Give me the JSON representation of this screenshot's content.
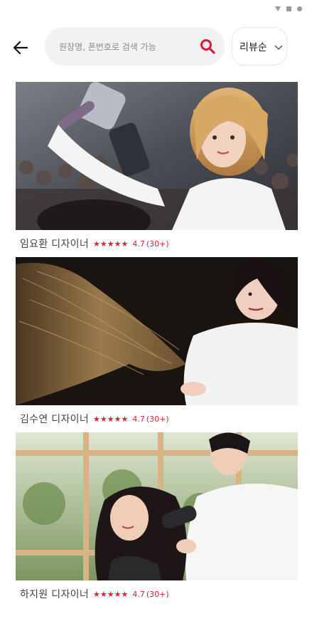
{
  "search": {
    "placeholder": "원장명, 폰번호로 검색 가능",
    "value": ""
  },
  "sort": {
    "label": "리뷰순"
  },
  "designers": [
    {
      "name": "임요환 디자이너",
      "stars": "★★★★★",
      "rating": "4.7",
      "count": "(30+)"
    },
    {
      "name": "김수연 디자이너",
      "stars": "★★★★★",
      "rating": "4.7",
      "count": "(30+)"
    },
    {
      "name": "하지원 디자이너",
      "stars": "★★★★★",
      "rating": "4.7",
      "count": "(30+)"
    }
  ],
  "colors": {
    "accent": "#e0203c",
    "search_bg": "#f2f2f2"
  }
}
